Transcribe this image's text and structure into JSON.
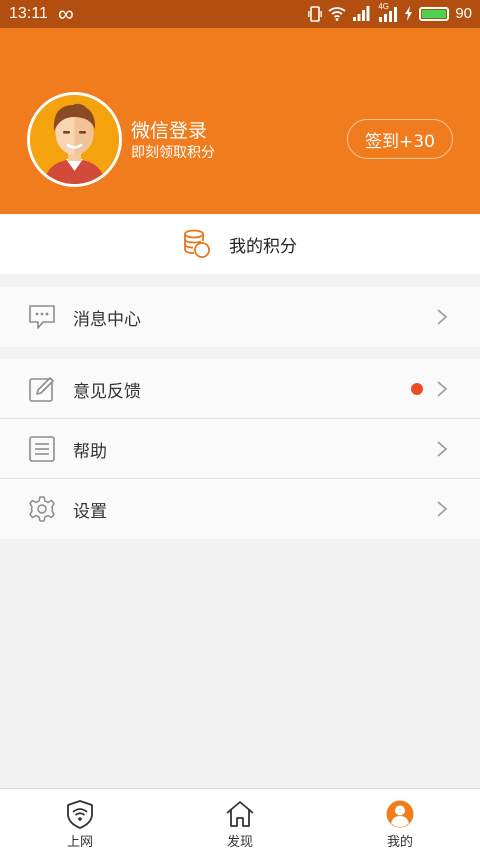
{
  "status_bar": {
    "time": "13:11",
    "loop_glyph": "∞",
    "network": "4G",
    "battery": "90",
    "battery_level": 0.9
  },
  "header": {
    "login_title": "微信登录",
    "login_subtitle": "即刻领取积分",
    "checkin_label": "签到+30"
  },
  "points": {
    "label": "我的积分"
  },
  "menu": {
    "messages": "消息中心",
    "feedback": "意见反馈",
    "help": "帮助",
    "settings": "设置"
  },
  "nav": {
    "internet": "上网",
    "discover": "发现",
    "mine": "我的"
  },
  "colors": {
    "status_bar": "#b24f10",
    "header": "#f07c1e",
    "accent": "#e8761d",
    "badge": "#ee4a24"
  }
}
